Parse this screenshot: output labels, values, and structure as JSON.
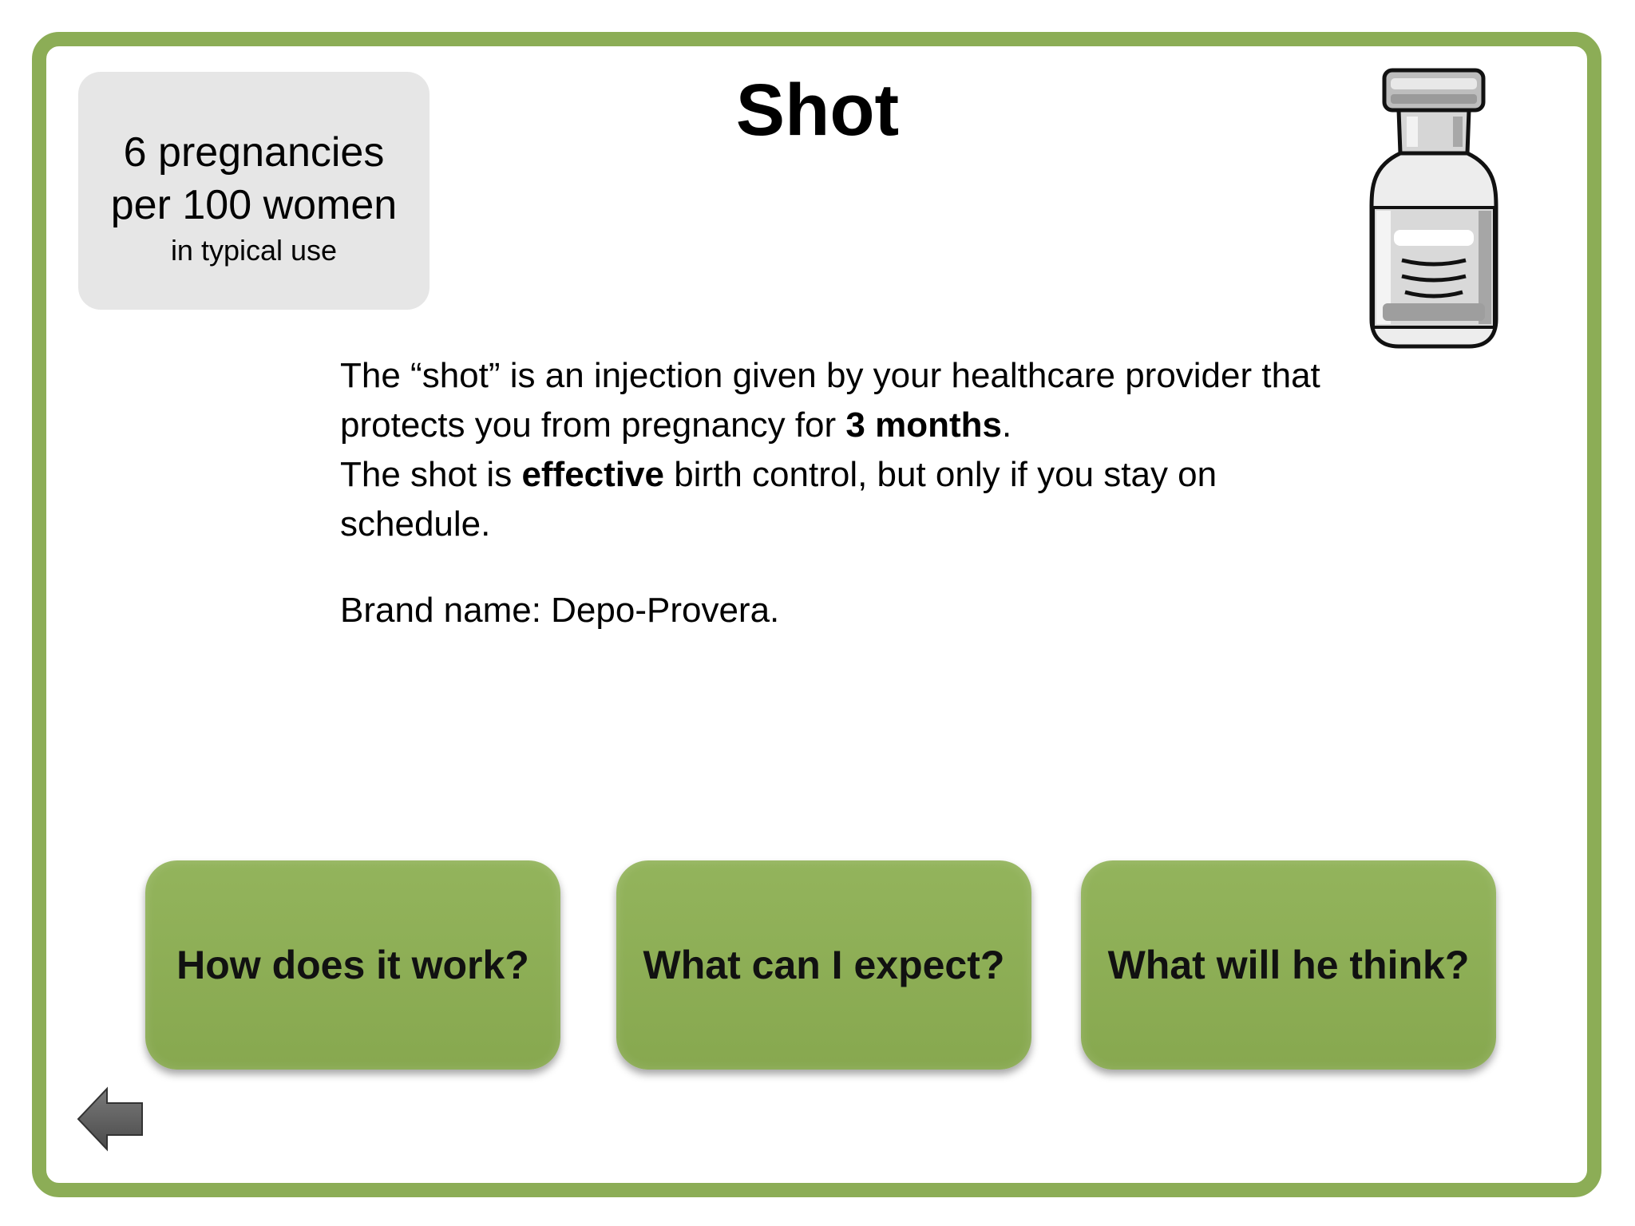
{
  "colors": {
    "frame_green": "#8cad56",
    "button_green": "#8ead57",
    "stat_box_gray": "#e6e6e6"
  },
  "stat_box": {
    "line1": "6 pregnancies",
    "line2": "per 100 women",
    "line3": "in typical use"
  },
  "title": "Shot",
  "vial_icon": "vial-icon",
  "description": {
    "p1_part1": "The “shot” is an injection given by your healthcare provider that protects you from pregnancy for ",
    "p1_bold": "3 months",
    "p1_part2": ".",
    "p2_part1": "The shot is ",
    "p2_bold": "effective",
    "p2_part2": " birth control, but only if you stay on schedule."
  },
  "brand": "Brand name: Depo-Provera.",
  "buttons": [
    {
      "label": "How does it work?"
    },
    {
      "label": "What can I expect?"
    },
    {
      "label": "What will he think?"
    }
  ],
  "back_icon": "back-arrow-icon"
}
